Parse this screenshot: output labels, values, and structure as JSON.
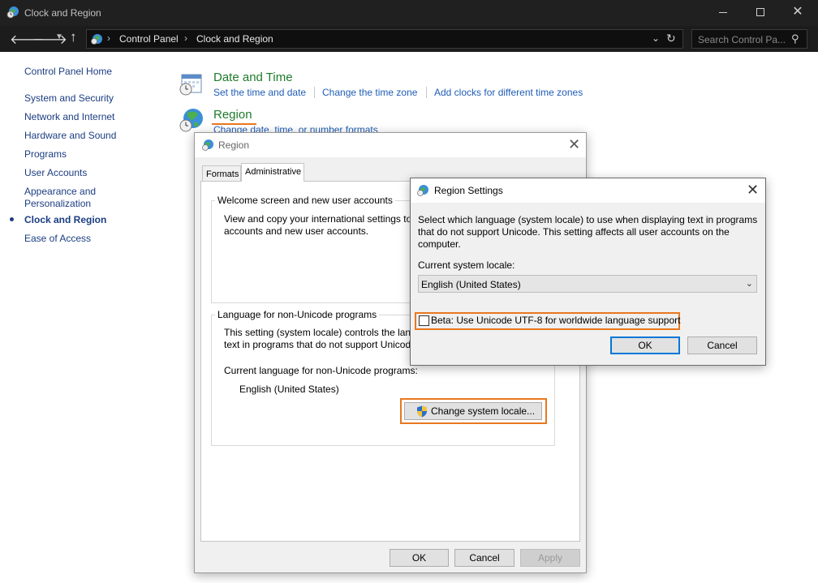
{
  "window": {
    "title": "Clock and Region"
  },
  "nav": {
    "breadcrumbs": [
      "Control Panel",
      "Clock and Region"
    ],
    "search_placeholder": "Search Control Pa..."
  },
  "sidebar": {
    "home": "Control Panel Home",
    "items": [
      {
        "label": "System and Security"
      },
      {
        "label": "Network and Internet"
      },
      {
        "label": "Hardware and Sound"
      },
      {
        "label": "Programs"
      },
      {
        "label": "User Accounts"
      },
      {
        "label": "Appearance and Personalization",
        "line1": "Appearance and",
        "line2": "Personalization"
      },
      {
        "label": "Clock and Region",
        "current": true
      },
      {
        "label": "Ease of Access"
      }
    ]
  },
  "content": {
    "datetime": {
      "title": "Date and Time",
      "links": [
        "Set the time and date",
        "Change the time zone",
        "Add clocks for different time zones"
      ]
    },
    "region": {
      "title": "Region",
      "links": [
        "Change date, time, or number formats"
      ]
    }
  },
  "region_dialog": {
    "title": "Region",
    "tabs": [
      "Formats",
      "Administrative"
    ],
    "active_tab": "Administrative",
    "welcome_group": {
      "legend": "Welcome screen and new user accounts",
      "text_line1": "View and copy your international settings to",
      "text_line2": "accounts and new user accounts."
    },
    "nonunicode_group": {
      "legend": "Language for non-Unicode programs",
      "text_line1": "This setting (system locale) controls the lang",
      "text_line2": "text in programs that do not support Unicod",
      "current_label": "Current language for non-Unicode programs:",
      "current_value": "English (United States)",
      "change_button": "Change system locale..."
    },
    "buttons": {
      "ok": "OK",
      "cancel": "Cancel",
      "apply": "Apply"
    }
  },
  "settings_dialog": {
    "title": "Region Settings",
    "desc_line1": "Select which language (system locale) to use when displaying text in programs",
    "desc_line2": "that do not support Unicode. This setting affects all user accounts on the",
    "desc_line3": "computer.",
    "locale_label": "Current system locale:",
    "locale_value": "English (United States)",
    "beta_label": "Beta: Use Unicode UTF-8 for worldwide language support",
    "beta_checked": false,
    "buttons": {
      "ok": "OK",
      "cancel": "Cancel"
    }
  },
  "colors": {
    "highlight": "#e8781e",
    "category_green": "#1e7b2a",
    "link_blue": "#1f5db5",
    "titlebar": "#202020"
  }
}
